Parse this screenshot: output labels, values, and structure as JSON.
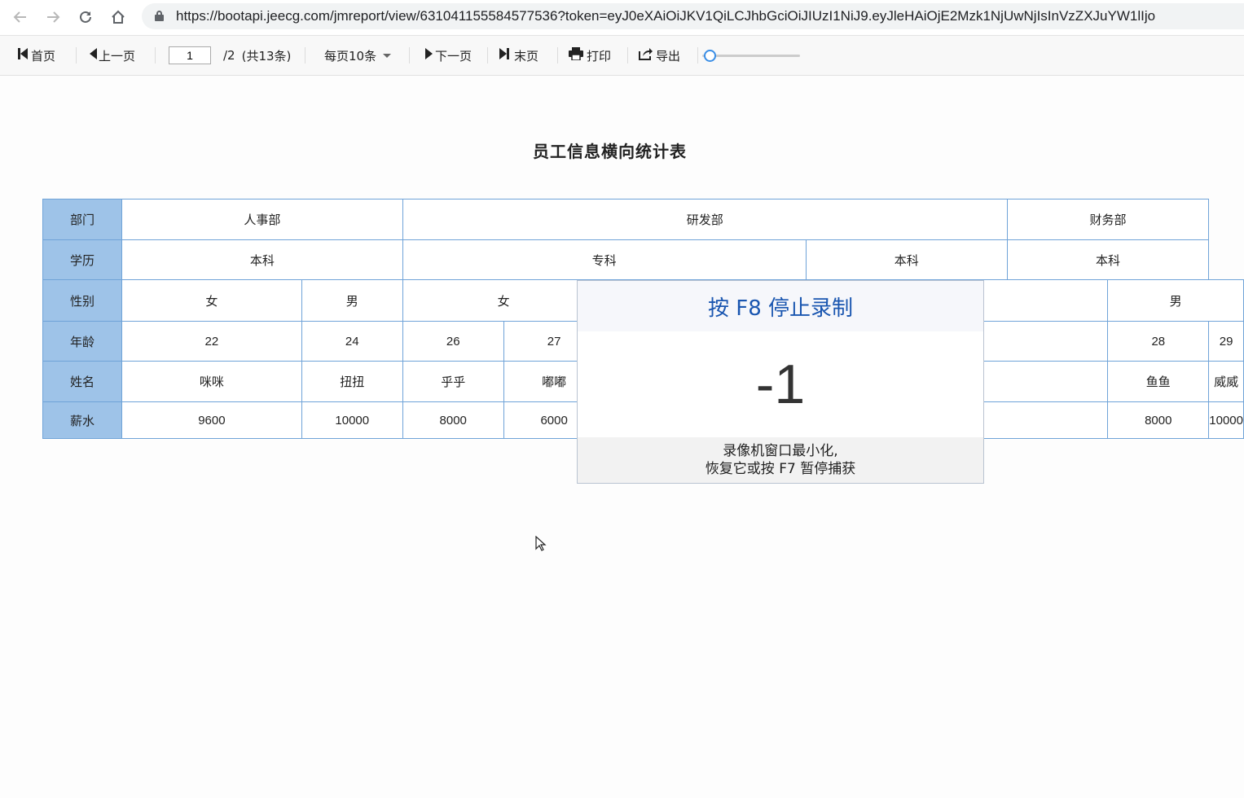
{
  "browser": {
    "url": "https://bootapi.jeecg.com/jmreport/view/631041155584577536?token=eyJ0eXAiOiJKV1QiLCJhbGciOiJIUzI1NiJ9.eyJleHAiOjE2Mzk1NjUwNjIsInVzZXJuYW1lIjo"
  },
  "toolbar": {
    "first": "首页",
    "prev": "上一页",
    "page_value": "1",
    "page_total": "/2",
    "record_count": "(共13条)",
    "page_size": "每页10条",
    "next": "下一页",
    "last": "末页",
    "print": "打印",
    "export": "导出",
    "zoom_level": 0.08
  },
  "report": {
    "title": "员工信息横向统计表",
    "row_labels": [
      "部门",
      "学历",
      "性别",
      "年龄",
      "姓名",
      "薪水"
    ],
    "departments": [
      "人事部",
      "研发部",
      "财务部"
    ],
    "education": [
      "本科",
      "专科",
      "本科",
      "本科"
    ],
    "gender": [
      "女",
      "男",
      "女",
      "男"
    ],
    "ages": [
      "22",
      "24",
      "26",
      "27",
      "28",
      "29"
    ],
    "names": [
      "咪咪",
      "扭扭",
      "乎乎",
      "嘟嘟",
      "鱼鱼",
      "威威"
    ],
    "salaries": [
      "9600",
      "10000",
      "8000",
      "6000",
      "8000",
      "10000"
    ]
  },
  "recorder": {
    "title": "按 F8 停止录制",
    "countdown": "-1",
    "line1": "录像机窗口最小化,",
    "line2": "恢复它或按 F7 暂停捕获"
  },
  "colors": {
    "header_bg": "#9ec3e8",
    "border": "#6fa3d8",
    "recorder_title": "#1a56b0"
  }
}
